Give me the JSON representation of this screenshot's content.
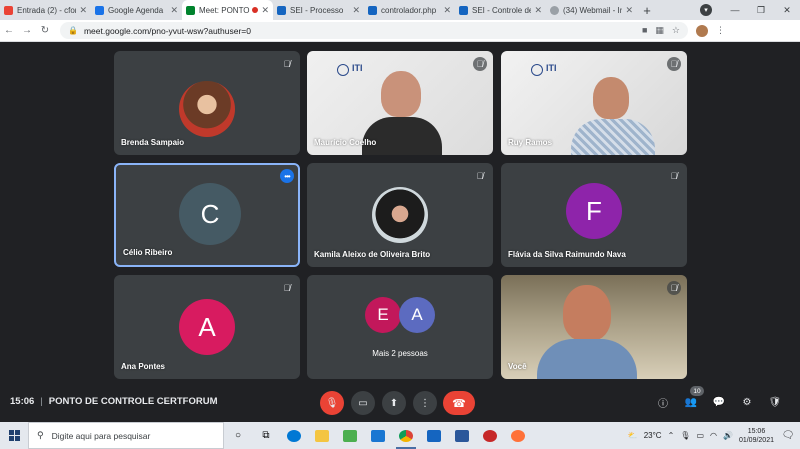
{
  "browser": {
    "tabs": [
      {
        "label": "Entrada (2) - cfor",
        "color": "#ea4335"
      },
      {
        "label": "Google Agenda",
        "color": "#1a73e8"
      },
      {
        "label": "Meet: PONTO",
        "color": "#00832d"
      },
      {
        "label": "SEI - Processo",
        "color": "#1565c0"
      },
      {
        "label": "controlador.php",
        "color": "#1565c0"
      },
      {
        "label": "SEI - Controle de",
        "color": "#1565c0"
      },
      {
        "label": "(34) Webmail - In",
        "color": "#9aa0a6"
      }
    ],
    "new_tab": "+",
    "url": "meet.google.com/pno-yvut-wsw?authuser=0"
  },
  "meeting": {
    "time": "15:06",
    "title": "PONTO DE CONTROLE CERTFORUM",
    "participant_count": "10"
  },
  "participants": [
    {
      "name": "Brenda Sampaio"
    },
    {
      "name": "Maurício Coelho",
      "logo": "ITI"
    },
    {
      "name": "Ruy Ramos",
      "logo": "ITI"
    },
    {
      "name": "Célio Ribeiro",
      "initial": "C",
      "color": "#455a64"
    },
    {
      "name": "Kamila Aleixo de Oliveira Brito"
    },
    {
      "name": "Flávia da Silva Raimundo Nava",
      "initial": "F",
      "color": "#8e24aa"
    },
    {
      "name": "Ana Pontes",
      "initial": "A",
      "color": "#d81b60"
    },
    {
      "name": "Mais 2 pessoas",
      "initials": [
        "E",
        "A"
      ],
      "colors": [
        "#c2185b",
        "#5c6bc0"
      ]
    },
    {
      "name": "Você"
    }
  ],
  "taskbar": {
    "search_placeholder": "Digite aqui para pesquisar",
    "temperature": "23°C",
    "time": "15:06",
    "date": "01/09/2021"
  }
}
